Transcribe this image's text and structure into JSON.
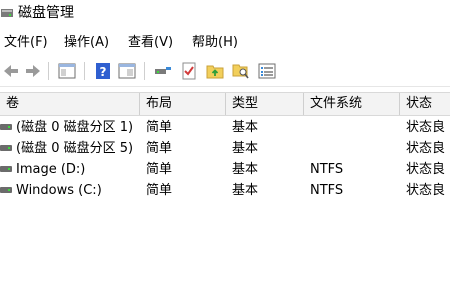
{
  "window": {
    "title": "磁盘管理",
    "icon": "disk-management-icon"
  },
  "menu": [
    "文件(F)",
    "操作(A)",
    "查看(V)",
    "帮助(H)"
  ],
  "toolbar": {
    "icons": [
      "back-arrow-icon",
      "forward-arrow-icon",
      "console-tree-icon",
      "help-icon",
      "properties-icon",
      "connect-icon",
      "check-icon",
      "folder-up-icon",
      "search-folder-icon",
      "list-view-icon"
    ]
  },
  "table": {
    "columns": [
      "卷",
      "布局",
      "类型",
      "文件系统",
      "状态"
    ],
    "rows": [
      {
        "volume": "(磁盘 0 磁盘分区 1)",
        "layout": "简单",
        "type": "基本",
        "fs": "",
        "status": "状态良"
      },
      {
        "volume": "(磁盘 0 磁盘分区 5)",
        "layout": "简单",
        "type": "基本",
        "fs": "",
        "status": "状态良"
      },
      {
        "volume": "Image (D:)",
        "layout": "简单",
        "type": "基本",
        "fs": "NTFS",
        "status": "状态良"
      },
      {
        "volume": "Windows (C:)",
        "layout": "简单",
        "type": "基本",
        "fs": "NTFS",
        "status": "状态良"
      }
    ]
  },
  "colors": {
    "header_bg": "#f3f3f3",
    "drive_green": "#3bdc3b",
    "help_blue": "#2f5fd0"
  }
}
